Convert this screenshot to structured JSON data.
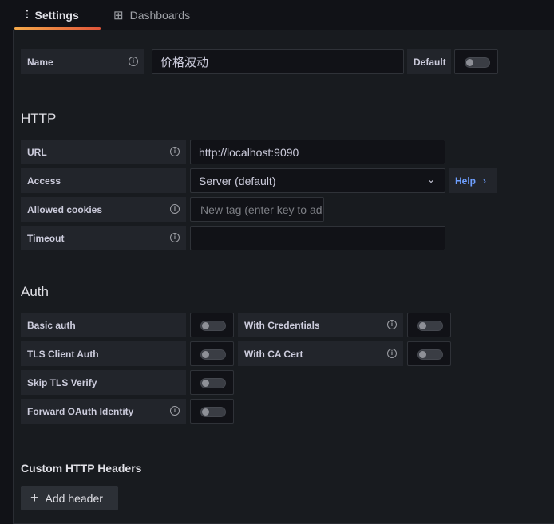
{
  "tabs": [
    {
      "label": "Settings",
      "icon": "sliders-icon",
      "active": true
    },
    {
      "label": "Dashboards",
      "icon": "apps-icon",
      "active": false
    }
  ],
  "name": {
    "label": "Name",
    "value": "价格波动",
    "default_label": "Default",
    "default_on": false
  },
  "http": {
    "title": "HTTP",
    "url_label": "URL",
    "url_value": "http://localhost:9090",
    "access_label": "Access",
    "access_value": "Server (default)",
    "help_label": "Help",
    "cookies_label": "Allowed cookies",
    "cookies_placeholder": "New tag (enter key to add)",
    "timeout_label": "Timeout",
    "timeout_value": ""
  },
  "auth": {
    "title": "Auth",
    "basic": "Basic auth",
    "tls_client": "TLS Client Auth",
    "skip_tls": "Skip TLS Verify",
    "forward_oauth": "Forward OAuth Identity",
    "with_credentials": "With Credentials",
    "with_ca": "With CA Cert"
  },
  "headers": {
    "title": "Custom HTTP Headers",
    "add_label": "Add header"
  }
}
